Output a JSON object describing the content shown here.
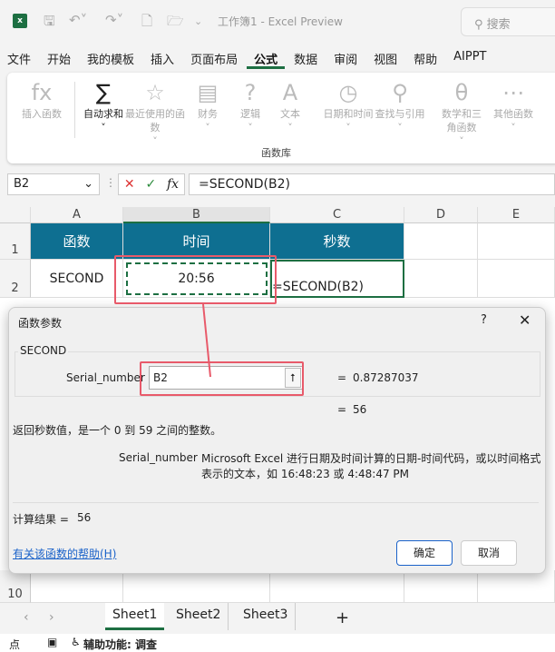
{
  "app": {
    "title": "工作簿1  -  Excel Preview",
    "search_placeholder": "搜索"
  },
  "menu": [
    "文件",
    "开始",
    "我的模板",
    "插入",
    "页面布局",
    "公式",
    "数据",
    "审阅",
    "视图",
    "帮助",
    "AIPPT"
  ],
  "menu_active": "公式",
  "ribbon": {
    "buttons": [
      {
        "label": "插入函数",
        "icon": "fx-icon",
        "glyph": "fx"
      },
      {
        "label": "自动求和",
        "icon": "sum-icon",
        "glyph": "∑",
        "dropdown": true
      },
      {
        "label": "最近使用的函数",
        "icon": "star-book-icon",
        "glyph": "☆",
        "dropdown": true
      },
      {
        "label": "财务",
        "icon": "coins-book-icon",
        "glyph": "▤",
        "dropdown": true
      },
      {
        "label": "逻辑",
        "icon": "question-book-icon",
        "glyph": "?",
        "dropdown": true
      },
      {
        "label": "文本",
        "icon": "text-book-icon",
        "glyph": "A",
        "dropdown": true
      },
      {
        "label": "日期和时间",
        "icon": "clock-book-icon",
        "glyph": "◷",
        "dropdown": true
      },
      {
        "label": "查找与引用",
        "icon": "search-book-icon",
        "glyph": "⚲",
        "dropdown": true
      },
      {
        "label": "数学和三角函数",
        "icon": "theta-book-icon",
        "glyph": "θ",
        "dropdown": true
      },
      {
        "label": "其他函数",
        "icon": "more-book-icon",
        "glyph": "⋯",
        "dropdown": true
      }
    ],
    "group_label": "函数库"
  },
  "formula_bar": {
    "name_box": "B2",
    "formula": "=SECOND(B2)"
  },
  "columns": [
    "A",
    "B",
    "C",
    "D",
    "E"
  ],
  "rows": [
    "1",
    "2",
    "10"
  ],
  "cells": {
    "A1": "函数",
    "B1": "时间",
    "C1": "秒数",
    "A2": "SECOND",
    "B2": "20:56",
    "C2": "=SECOND(B2)"
  },
  "colors": {
    "header_fill": "#0e6f91",
    "accent": "#1d6f42",
    "highlight": "#e85a6a",
    "link": "#1a62c9"
  },
  "dialog": {
    "title": "函数参数",
    "help_glyph": "?",
    "function_name": "SECOND",
    "arg_label": "Serial_number",
    "arg_value": "B2",
    "arg_result": "0.87287037",
    "eq": "=",
    "result": "56",
    "description": "返回秒数值，是一个 0 到 59 之间的整数。",
    "arg_desc_label": "Serial_number",
    "arg_desc": "Microsoft Excel 进行日期及时间计算的日期-时间代码，或以时间格式表示的文本，如 16:48:23 或 4:48:47 PM",
    "calc_label": "计算结果 =",
    "calc_value": "56",
    "help_link": "有关该函数的帮助(H)",
    "ok": "确定",
    "cancel": "取消"
  },
  "sheets": [
    "Sheet1",
    "Sheet2",
    "Sheet3"
  ],
  "active_sheet": "Sheet1",
  "add_sheet": "+",
  "status": {
    "mode": "点",
    "accessibility": "辅助功能: 调查"
  }
}
